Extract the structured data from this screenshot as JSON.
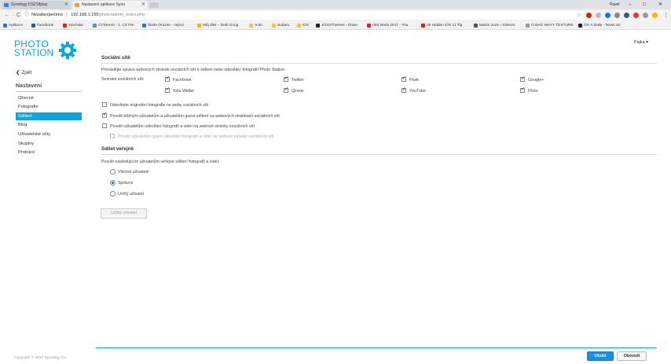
{
  "browser": {
    "tabs": [
      {
        "title": "Synology DS218play"
      },
      {
        "title": "Nastavení aplikace Syno"
      }
    ],
    "user": "Pavel",
    "window_controls": [
      "–",
      "□",
      "✕"
    ],
    "nav": {
      "back": "←",
      "forward": "→",
      "reload": "C"
    },
    "address": {
      "security": "Nezabezpečeno",
      "host": "192.168.1.155",
      "path": "/photo/admin_index.php"
    },
    "bookmarks": [
      {
        "label": "Aplikace",
        "color": "#4a6fa5"
      },
      {
        "label": "Facebook",
        "color": "#3b5998"
      },
      {
        "label": "YouTube",
        "color": "#e62117"
      },
      {
        "label": "CzTorrent - 1. CZ Fre",
        "color": "#5b8fc7"
      },
      {
        "label": "Škole OnLine - nejroz",
        "color": "#2d7ab9"
      },
      {
        "label": "Můj disk – Disk Goog",
        "color": "#f4b400"
      },
      {
        "label": "Auto",
        "color": "#f0c44a"
      },
      {
        "label": "Subaru",
        "color": "#f0c44a"
      },
      {
        "label": "iOS",
        "color": "#f0c44a"
      },
      {
        "label": "JOJOThemes - Down",
        "color": "#222222"
      },
      {
        "label": "(55) Brela 2017 - You",
        "color": "#e62117"
      },
      {
        "label": "28 Hidden iOS 11 Tip",
        "color": "#cc2222"
      },
      {
        "label": "Martin Juza – Directo",
        "color": "#555555"
      },
      {
        "label": "O BAG WAYY TEXTURE",
        "color": "#999999"
      },
      {
        "label": "OS X Daily - News an",
        "color": "#222222"
      }
    ]
  },
  "app": {
    "logo": {
      "line1": "PHOTO",
      "line2": "STATION"
    },
    "back_label": "Zpět",
    "section_label": "Nastavení",
    "menu": [
      {
        "label": "Obecné",
        "active": false
      },
      {
        "label": "Fotografie",
        "active": false
      },
      {
        "label": "Sdílení",
        "active": true
      },
      {
        "label": "Blog",
        "active": false
      },
      {
        "label": "Uživatelské účty",
        "active": false
      },
      {
        "label": "Skupiny",
        "active": false
      },
      {
        "label": "Protokol",
        "active": false
      }
    ],
    "copyright": "Copyright © 2017 Synology Inc.",
    "user_menu": "Pajka ▾"
  },
  "social": {
    "heading": "Sociální sítě",
    "description": "Provádějte správu webových stránek sociálních sítí a sdílení nebo odesílání fotografií Photo Station.",
    "list_label": "Seznam sociálních sítí:",
    "networks": [
      {
        "label": "Facebook",
        "checked": true
      },
      {
        "label": "Twitter",
        "checked": true
      },
      {
        "label": "Plurk",
        "checked": true
      },
      {
        "label": "Google+",
        "checked": true
      },
      {
        "label": "Sina Weibo",
        "checked": true
      },
      {
        "label": "Qzone",
        "checked": true
      },
      {
        "label": "YouTube",
        "checked": true
      },
      {
        "label": "Flickr",
        "checked": true
      }
    ],
    "options": [
      {
        "label": "Odesílejte originální fotografie na weby sociálních sítí",
        "checked": false,
        "disabled": false
      },
      {
        "label": "Povolit běžným uživatelům a uživatelům guest sdílení na webových stránkách sociálních sítí",
        "checked": true,
        "disabled": false
      },
      {
        "label": "Povolit uživatelům odesílání fotografií a videí na webové stránky sociálních sítí",
        "checked": false,
        "disabled": false
      },
      {
        "label": "Povolit uživatelům guest odesílání fotografií a videí na webové stránky sociálních sítí",
        "checked": false,
        "disabled": true
      }
    ]
  },
  "public_share": {
    "heading": "Sdílet veřejně",
    "description": "Povolit následujícím uživatelům veřejné sdílení fotografií a videí:",
    "options": [
      {
        "label": "Všichni uživatelé",
        "selected": false
      },
      {
        "label": "Správce",
        "selected": true
      },
      {
        "label": "Určitý uživatel",
        "selected": false
      }
    ],
    "user_button": "Určitý uživatel"
  },
  "footer": {
    "save": "Uložit",
    "reset": "Obnovit"
  },
  "colors": {
    "accent": "#0aa7d8",
    "primary_button": "#1a8fde",
    "checkmark": "#1a6bb7"
  }
}
